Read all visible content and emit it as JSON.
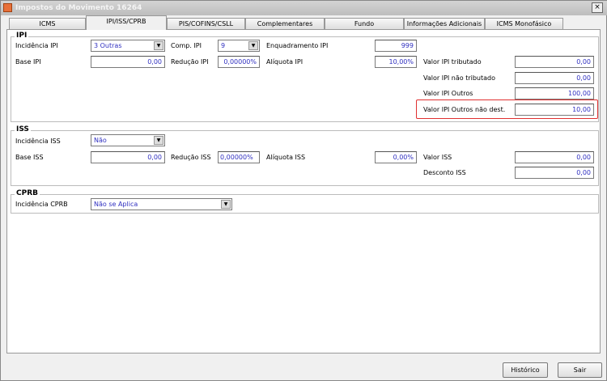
{
  "window": {
    "title": "Impostos do Movimento 16264",
    "close": "×"
  },
  "tabs": [
    "ICMS",
    "IPI/ISS/CPRB",
    "PIS/COFINS/CSLL",
    "Complementares",
    "Fundo Pobreza/Rural/FTI",
    "Informações Adicionais",
    "ICMS Monofásico"
  ],
  "ipi": {
    "title": "IPI",
    "incidencia_label": "Incidência IPI",
    "incidencia_value": "3 Outras",
    "comp_label": "Comp. IPI",
    "comp_value": "9",
    "enquadramento_label": "Enquadramento IPI",
    "enquadramento_value": "999",
    "base_label": "Base IPI",
    "base_value": "0,00",
    "reducao_label": "Redução IPI",
    "reducao_value": "0,00000%",
    "aliquota_label": "Alíquota IPI",
    "aliquota_value": "10,00%",
    "tributado_label": "Valor IPI tributado",
    "tributado_value": "0,00",
    "nao_tributado_label": "Valor IPI não tributado",
    "nao_tributado_value": "0,00",
    "outros_label": "Valor IPI Outros",
    "outros_value": "100,00",
    "outros_nd_label": "Valor IPI Outros não dest.",
    "outros_nd_value": "10,00"
  },
  "iss": {
    "title": "ISS",
    "incidencia_label": "Incidência ISS",
    "incidencia_value": "Não",
    "base_label": "Base ISS",
    "base_value": "0,00",
    "reducao_label": "Redução ISS",
    "reducao_value": "0,00000%",
    "aliquota_label": "Alíquota ISS",
    "aliquota_value": "0,00%",
    "valor_label": "Valor ISS",
    "valor_value": "0,00",
    "desconto_label": "Desconto ISS",
    "desconto_value": "0,00"
  },
  "cprb": {
    "title": "CPRB",
    "incidencia_label": "Incidência CPRB",
    "incidencia_value": "Não se Aplica"
  },
  "buttons": {
    "historico": "Histórico",
    "sair": "Sair"
  },
  "arrow": "▼"
}
